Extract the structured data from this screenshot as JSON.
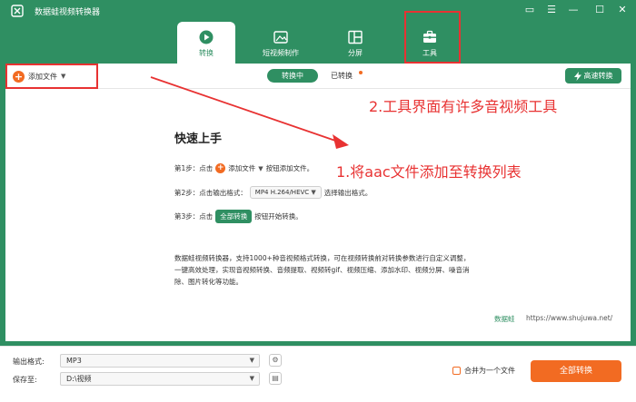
{
  "app": {
    "title": "数据蛙视频转换器",
    "accent": "#2f8f62",
    "orange": "#f26b22",
    "window_controls": [
      {
        "name": "message-icon",
        "glyph": "▭"
      },
      {
        "name": "menu-icon",
        "glyph": "☰"
      },
      {
        "name": "minimize-icon",
        "glyph": "—"
      },
      {
        "name": "maximize-icon",
        "glyph": "☐"
      },
      {
        "name": "close-icon",
        "glyph": "✕"
      }
    ]
  },
  "nav": {
    "tabs": [
      {
        "label": "转换",
        "icon": "convert-icon",
        "active": true
      },
      {
        "label": "短视频制作",
        "icon": "short-video-icon",
        "active": false
      },
      {
        "label": "分屏",
        "icon": "split-screen-icon",
        "active": false
      },
      {
        "label": "工具",
        "icon": "toolbox-icon",
        "active": false
      }
    ]
  },
  "toolbar": {
    "add_file": "添加文件",
    "converting": "转换中",
    "converted": "已转换",
    "fast_convert": "高速转换"
  },
  "guide": {
    "title": "快速上手",
    "step1_prefix": "第1步：点击",
    "step1_button": "添加文件",
    "step1_suffix": "按钮添加文件。",
    "step2_prefix": "第2步：点击输出格式：",
    "step2_format": "MP4 H.264/HEVC",
    "step2_suffix": "选择输出格式。",
    "step3_prefix": "第3步：点击",
    "step3_button": "全部转换",
    "step3_suffix": "按钮开始转换。",
    "description": "数据蛙视频转换器，支持1000+种音视频格式转换，可在视频转换前对转换参数进行自定义调整，一键高效处理，实现音视频转换、音频提取、视频转gif、视频压缩、添加水印、视频分屏、噪音消除、图片转化等功能。",
    "brand": "数据蛙",
    "url": "https://www.shujuwa.net/"
  },
  "bottom": {
    "output_format_label": "输出格式:",
    "output_format_value": "MP3",
    "save_to_label": "保存至:",
    "save_to_value": "D:\\视频",
    "merge_label": "合并为一个文件",
    "convert_all": "全部转换"
  },
  "annotations": {
    "note1": "1.将aac文件添加至转换列表",
    "note2": "2.工具界面有许多音视频工具",
    "color": "#e83232"
  }
}
